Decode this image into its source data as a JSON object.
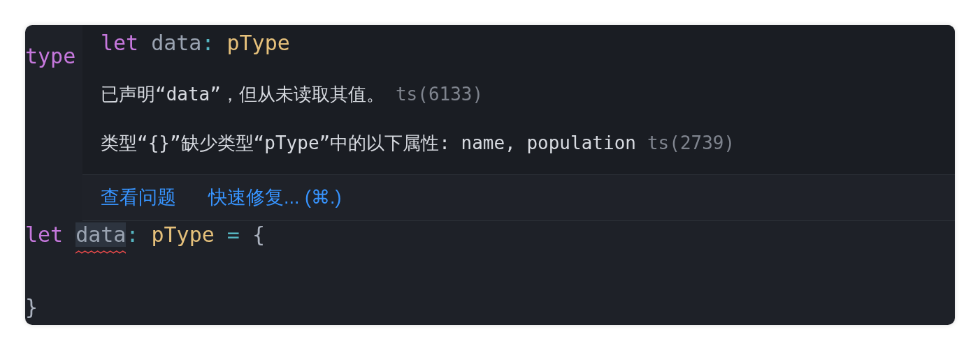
{
  "editor": {
    "lines_above": [
      {
        "tokens": [
          {
            "text": "type",
            "kind": "keyword"
          }
        ]
      }
    ],
    "lines_below": [
      {
        "tokens": [
          {
            "text": "let",
            "kind": "keyword"
          },
          {
            "text": "data",
            "kind": "variable",
            "error": true,
            "highlighted": true
          },
          {
            "text": ":",
            "kind": "punct"
          },
          {
            "text": "pType",
            "kind": "type"
          },
          {
            "text": "=",
            "kind": "operator"
          },
          {
            "text": "{",
            "kind": "brace"
          }
        ]
      },
      {
        "tokens": [
          {
            "text": "}",
            "kind": "brace"
          }
        ]
      }
    ]
  },
  "hover": {
    "signature": [
      {
        "text": "let",
        "kind": "keyword"
      },
      {
        "text": "data",
        "kind": "variable"
      },
      {
        "text": ":",
        "kind": "punct"
      },
      {
        "text": "pType",
        "kind": "type"
      }
    ],
    "messages": [
      {
        "text": "已声明“data”，但从未读取其值。",
        "code": "ts(6133)"
      },
      {
        "text": "类型“{}”缺少类型“pType”中的以下属性: name, population",
        "code": "ts(2739)"
      }
    ],
    "actions": [
      "查看问题",
      "快速修复... (⌘.)"
    ]
  }
}
